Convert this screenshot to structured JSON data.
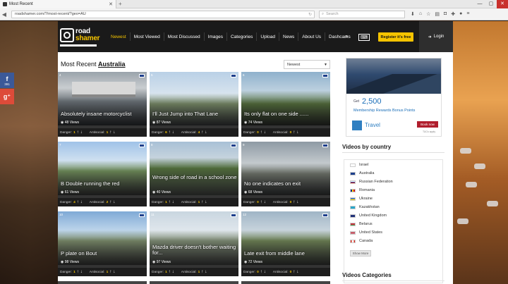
{
  "browser": {
    "tab_title": "Most Recent",
    "url": "roadshamer.com/?/most-recent/?geo=AU",
    "search_placeholder": "Search"
  },
  "share": {
    "facebook_count": "391"
  },
  "site": {
    "logo_word1": "road",
    "logo_word2": "shamer",
    "nav": [
      "Newest",
      "Most Viewed",
      "Most Discussed",
      "Images",
      "Categories",
      "Upload",
      "News",
      "About Us",
      "Dashcams"
    ],
    "register_label": "Register it's free",
    "login_label": "Login"
  },
  "main": {
    "heading_prefix": "Most Recent",
    "heading_country": "Australia",
    "sort_selected": "Newest",
    "danger_label": "Danger:",
    "antisocial_label": "Antisocial:",
    "videos": [
      {
        "title": "Absolutely insane motorcyclist",
        "views": "48 Views",
        "danger": "1",
        "antisocial": "1"
      },
      {
        "title": "I'll Just Jump into That Lane",
        "views": "87 Views",
        "danger": "6",
        "antisocial": "4"
      },
      {
        "title": "Its only flat on one side ......",
        "views": "74 Views",
        "danger": "0",
        "antisocial": "0"
      },
      {
        "title": "B Double running the red",
        "views": "61 Views",
        "danger": "4",
        "antisocial": "2"
      },
      {
        "title": "Wrong side of road in a school zone",
        "views": "40 Views",
        "danger": "1",
        "antisocial": "1"
      },
      {
        "title": "No one indicates on exit",
        "views": "68 Views",
        "danger": "0",
        "antisocial": "0"
      },
      {
        "title": "P plate on Bout",
        "views": "98 Views",
        "danger": "1",
        "antisocial": "1"
      },
      {
        "title": "Mazda driver doesn't bother waiting for...",
        "views": "97 Views",
        "danger": "1",
        "antisocial": "1"
      },
      {
        "title": "Late exit from middle lane",
        "views": "72 Views",
        "danger": "0",
        "antisocial": "0"
      }
    ]
  },
  "sidebar": {
    "ad": {
      "get": "Get",
      "points": "2,500",
      "line": "Membership Rewards Bonus Points",
      "brand": "Travel",
      "cta": "Book now",
      "tc": "T&Cs apply"
    },
    "countries_title": "Videos by country",
    "countries": [
      "Israel",
      "Australia",
      "Russian Federation",
      "Romania",
      "Ukraine",
      "Kazakhstan",
      "United Kingdom",
      "Belarus",
      "United States",
      "Canada"
    ],
    "show_more": "Show More",
    "categories_title": "Videos Categories"
  },
  "colors": {
    "accent": "#f5c400",
    "header_bg": "#1a1a1a"
  }
}
